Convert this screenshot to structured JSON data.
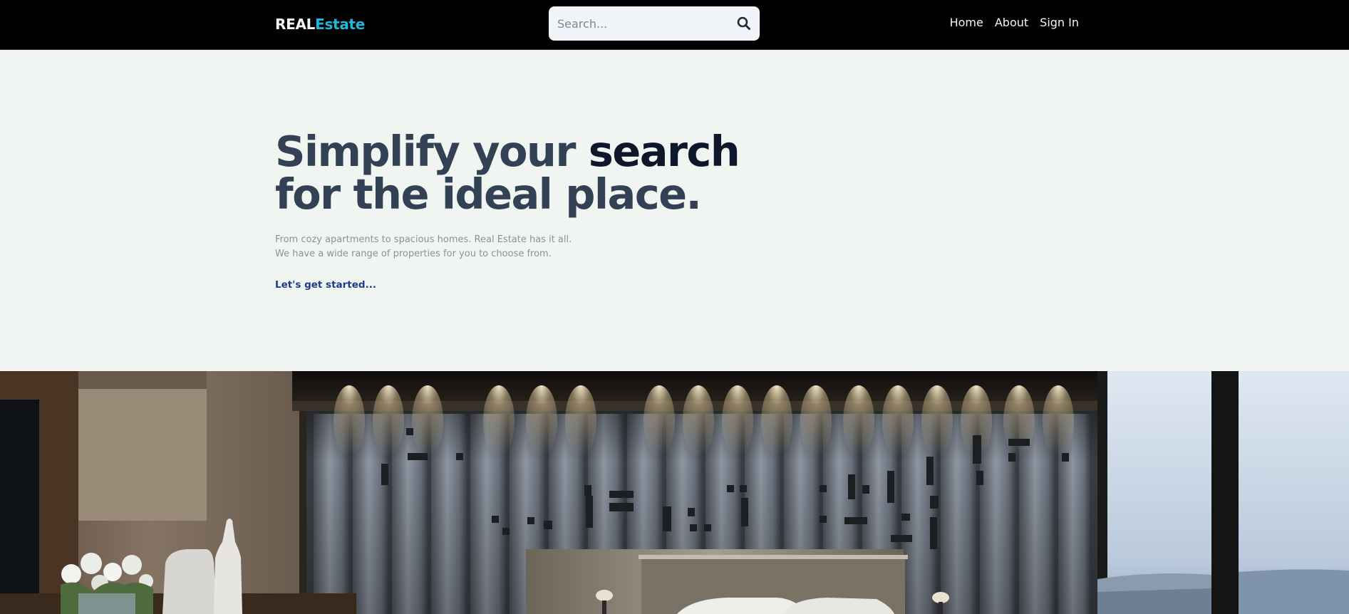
{
  "header": {
    "logo_part1": "REAL",
    "logo_part2": "Estate",
    "search_placeholder": "Search...",
    "search_icon": "search-icon",
    "nav": [
      {
        "label": "Home"
      },
      {
        "label": "About"
      },
      {
        "label": "Sign In"
      }
    ]
  },
  "hero": {
    "headline_part1": "Simplify your ",
    "headline_part2": "search",
    "headline_line2": "for the ideal place.",
    "subtitle_line1": "From cozy apartments to spacious homes. Real Estate has it all.",
    "subtitle_line2": "We have a wide range of properties for you to choose from.",
    "cta_label": "Let's get started..."
  },
  "image": {
    "subject": "bedroom-interior-photo"
  },
  "colors": {
    "header_bg": "#000000",
    "page_bg": "#f0f5f2",
    "brand_accent": "#22b8d8",
    "headline": "#334155",
    "cta": "#1e3a8a"
  }
}
